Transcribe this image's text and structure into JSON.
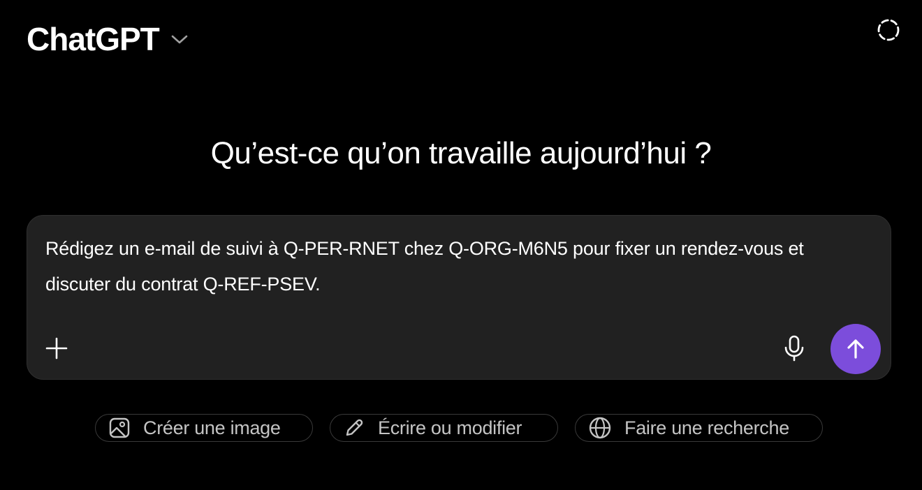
{
  "header": {
    "brand": "ChatGPT",
    "model_menu_icon": "chevron-down-icon",
    "temporary_chat_icon": "dashed-circle-icon"
  },
  "main": {
    "headline": "Qu’est-ce qu’on travaille aujourd’hui ?"
  },
  "composer": {
    "prompt_text": "Rédigez un e-mail de suivi à Q-PER-RNET chez Q-ORG-M6N5 pour fixer un rendez-vous et discuter du contrat Q-REF-PSEV.",
    "attach_icon": "plus-icon",
    "mic_icon": "microphone-icon",
    "send_icon": "arrow-up-icon"
  },
  "suggestions": [
    {
      "label": "Créer une image",
      "icon": "image-icon"
    },
    {
      "label": "Écrire ou modifier",
      "icon": "pencil-icon"
    },
    {
      "label": "Faire une recherche",
      "icon": "globe-icon"
    }
  ],
  "colors": {
    "background": "#000000",
    "composer_bg": "#212121",
    "accent": "#7c4ddb",
    "chip_text": "#c4c4c4"
  }
}
